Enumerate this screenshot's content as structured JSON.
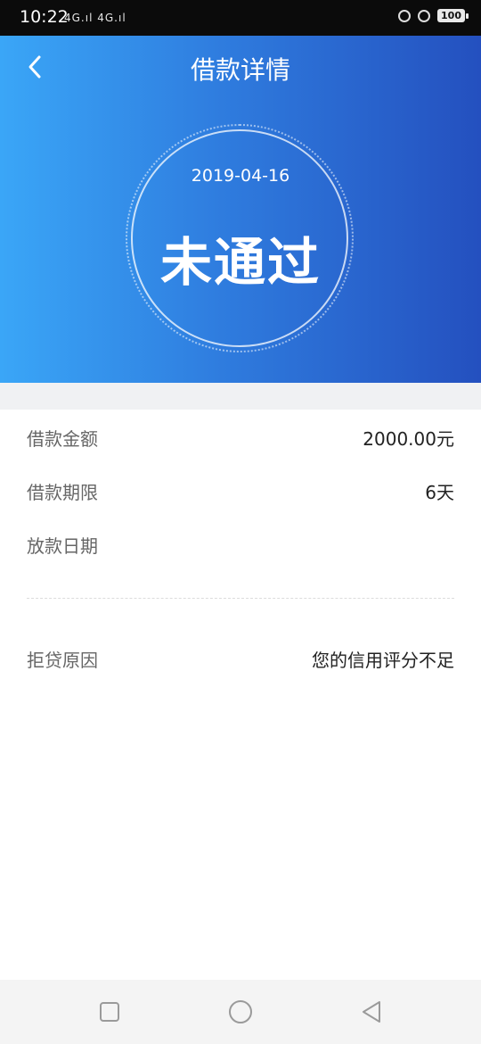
{
  "status_bar": {
    "time": "10:22",
    "signal_text": "4G.ıl 4G.ıl",
    "battery": "100"
  },
  "header": {
    "title": "借款详情",
    "date": "2019-04-16",
    "status": "未通过"
  },
  "details": {
    "amount": {
      "label": "借款金额",
      "value": "2000.00元"
    },
    "term": {
      "label": "借款期限",
      "value": "6天"
    },
    "disburse_date": {
      "label": "放款日期",
      "value": ""
    },
    "reject_reason": {
      "label": "拒贷原因",
      "value": "您的信用评分不足"
    }
  },
  "colors": {
    "gradient_start": "#3aa6f7",
    "gradient_end": "#2450bf"
  }
}
